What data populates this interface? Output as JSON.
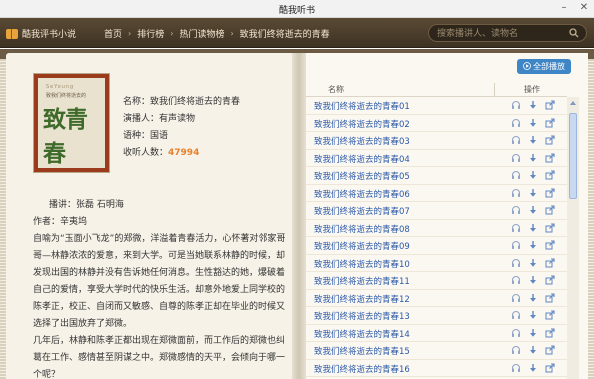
{
  "window": {
    "title": "酷我听书"
  },
  "header": {
    "app_name": "酷我评书小说",
    "breadcrumbs": [
      "首页",
      "排行榜",
      "热门读物榜",
      "致我们终将逝去的青春"
    ],
    "search_placeholder": "搜索播讲人、读物名"
  },
  "book": {
    "cover": {
      "top_text": "SeYoung",
      "sub_text": "致我们终将逝去的",
      "big_text": "致青春"
    },
    "name_line": "名称：致我们终将逝去的青春",
    "narrator_line": "演播人：有声读物",
    "language_line": "语种：国语",
    "collect_label": "收听人数：",
    "collect_count": "47994",
    "narrators": "播讲：张磊  石明海",
    "author": "作者：辛夷坞",
    "description_1": "自喻为“玉面小飞龙”的郑微，洋溢着青春活力，心怀著对邻家哥哥—林静浓浓的爱意，来到大学。可是当她联系林静的时候，却发现出国的林静并没有告诉她任何消息。生性豁达的她，爆破着自己的爱情，享受大学时代的快乐生活。却意外地爱上同学校的陈孝正，校正、自闭而又敏感、自尊的陈孝正却在毕业的时候又选择了出国放弃了郑微。",
    "description_2": "几年后，林静和陈孝正都出现在郑微面前，而工作后的郑微也纠葛在工作、感情甚至阴谋之中。郑微感情的天平，会倾向于哪一个呢？"
  },
  "playlist": {
    "play_all_label": "全部播放",
    "col_name": "名称",
    "col_ops": "操作",
    "items": [
      "致我们终将逝去的青春01",
      "致我们终将逝去的青春02",
      "致我们终将逝去的青春03",
      "致我们终将逝去的青春04",
      "致我们终将逝去的青春05",
      "致我们终将逝去的青春06",
      "致我们终将逝去的青春07",
      "致我们终将逝去的青春08",
      "致我们终将逝去的青春09",
      "致我们终将逝去的青春10",
      "致我们终将逝去的青春11",
      "致我们终将逝去的青春12",
      "致我们终将逝去的青春13",
      "致我们终将逝去的青春14",
      "致我们终将逝去的青春15",
      "致我们终将逝去的青春16"
    ],
    "op_icons": [
      "headphone-icon",
      "download-icon",
      "share-icon"
    ]
  },
  "colors": {
    "header_bg": "#4a3c2b",
    "link": "#2a58a8",
    "accent": "#3f86c7",
    "count": "#e8802d"
  }
}
